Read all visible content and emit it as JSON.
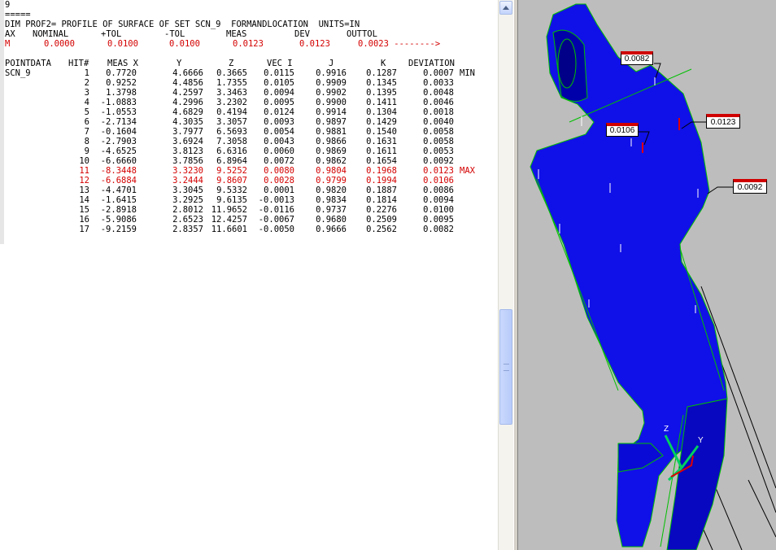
{
  "report": {
    "lines_top": [
      "9",
      "=====",
      "DIM PROF2= PROFILE OF SURFACE OF SET SCN_9  FORMANDLOCATION  UNITS=IN"
    ],
    "axis_header": [
      "AX",
      "NOMINAL",
      "+TOL",
      "-TOL",
      "MEAS",
      "DEV",
      "OUTTOL"
    ],
    "axis_row": [
      "M",
      "0.0000",
      "0.0100",
      "0.0100",
      "0.0123",
      "0.0123",
      "0.0023 -------->"
    ],
    "table_headers": [
      "POINTDATA",
      "HIT#",
      "MEAS X",
      "Y",
      "Z",
      "VEC I",
      "J",
      "K",
      "DEVIATION"
    ],
    "set_name": "SCN_9",
    "rows": [
      {
        "hit": "1",
        "x": "0.7720",
        "y": "4.6666",
        "z": "0.3665",
        "i": "0.0115",
        "j": "0.9916",
        "k": "0.1287",
        "dev": "0.0007",
        "flag": "MIN",
        "red": false
      },
      {
        "hit": "2",
        "x": "0.9252",
        "y": "4.4856",
        "z": "1.7355",
        "i": "0.0105",
        "j": "0.9909",
        "k": "0.1345",
        "dev": "0.0033",
        "flag": "",
        "red": false
      },
      {
        "hit": "3",
        "x": "1.3798",
        "y": "4.2597",
        "z": "3.3463",
        "i": "0.0094",
        "j": "0.9902",
        "k": "0.1395",
        "dev": "0.0048",
        "flag": "",
        "red": false
      },
      {
        "hit": "4",
        "x": "-1.0883",
        "y": "4.2996",
        "z": "3.2302",
        "i": "0.0095",
        "j": "0.9900",
        "k": "0.1411",
        "dev": "0.0046",
        "flag": "",
        "red": false
      },
      {
        "hit": "5",
        "x": "-1.0553",
        "y": "4.6829",
        "z": "0.4194",
        "i": "0.0124",
        "j": "0.9914",
        "k": "0.1304",
        "dev": "0.0018",
        "flag": "",
        "red": false
      },
      {
        "hit": "6",
        "x": "-2.7134",
        "y": "4.3035",
        "z": "3.3057",
        "i": "0.0093",
        "j": "0.9897",
        "k": "0.1429",
        "dev": "0.0040",
        "flag": "",
        "red": false
      },
      {
        "hit": "7",
        "x": "-0.1604",
        "y": "3.7977",
        "z": "6.5693",
        "i": "0.0054",
        "j": "0.9881",
        "k": "0.1540",
        "dev": "0.0058",
        "flag": "",
        "red": false
      },
      {
        "hit": "8",
        "x": "-2.7903",
        "y": "3.6924",
        "z": "7.3058",
        "i": "0.0043",
        "j": "0.9866",
        "k": "0.1631",
        "dev": "0.0058",
        "flag": "",
        "red": false
      },
      {
        "hit": "9",
        "x": "-4.6525",
        "y": "3.8123",
        "z": "6.6316",
        "i": "0.0060",
        "j": "0.9869",
        "k": "0.1611",
        "dev": "0.0053",
        "flag": "",
        "red": false
      },
      {
        "hit": "10",
        "x": "-6.6660",
        "y": "3.7856",
        "z": "6.8964",
        "i": "0.0072",
        "j": "0.9862",
        "k": "0.1654",
        "dev": "0.0092",
        "flag": "",
        "red": false
      },
      {
        "hit": "11",
        "x": "-8.3448",
        "y": "3.3230",
        "z": "9.5252",
        "i": "0.0080",
        "j": "0.9804",
        "k": "0.1968",
        "dev": "0.0123",
        "flag": "MAX",
        "red": true
      },
      {
        "hit": "12",
        "x": "-6.6884",
        "y": "3.2444",
        "z": "9.8607",
        "i": "0.0028",
        "j": "0.9799",
        "k": "0.1994",
        "dev": "0.0106",
        "flag": "",
        "red": true
      },
      {
        "hit": "13",
        "x": "-4.4701",
        "y": "3.3045",
        "z": "9.5332",
        "i": "0.0001",
        "j": "0.9820",
        "k": "0.1887",
        "dev": "0.0086",
        "flag": "",
        "red": false
      },
      {
        "hit": "14",
        "x": "-1.6415",
        "y": "3.2925",
        "z": "9.6135",
        "i": "-0.0013",
        "j": "0.9834",
        "k": "0.1814",
        "dev": "0.0094",
        "flag": "",
        "red": false
      },
      {
        "hit": "15",
        "x": "-2.8918",
        "y": "2.8012",
        "z": "11.9652",
        "i": "-0.0116",
        "j": "0.9737",
        "k": "0.2276",
        "dev": "0.0100",
        "flag": "",
        "red": false
      },
      {
        "hit": "16",
        "x": "-5.9086",
        "y": "2.6523",
        "z": "12.4257",
        "i": "-0.0067",
        "j": "0.9680",
        "k": "0.2509",
        "dev": "0.0095",
        "flag": "",
        "red": false
      },
      {
        "hit": "17",
        "x": "-9.2159",
        "y": "2.8357",
        "z": "11.6601",
        "i": "-0.0050",
        "j": "0.9666",
        "k": "0.2562",
        "dev": "0.0082",
        "flag": "",
        "red": false
      }
    ]
  },
  "viewport": {
    "part_color": "#1010e8",
    "callouts": [
      "0.0082",
      "0.0106",
      "0.0123",
      "0.0092"
    ],
    "axis_labels": [
      "Z",
      "Y"
    ]
  }
}
